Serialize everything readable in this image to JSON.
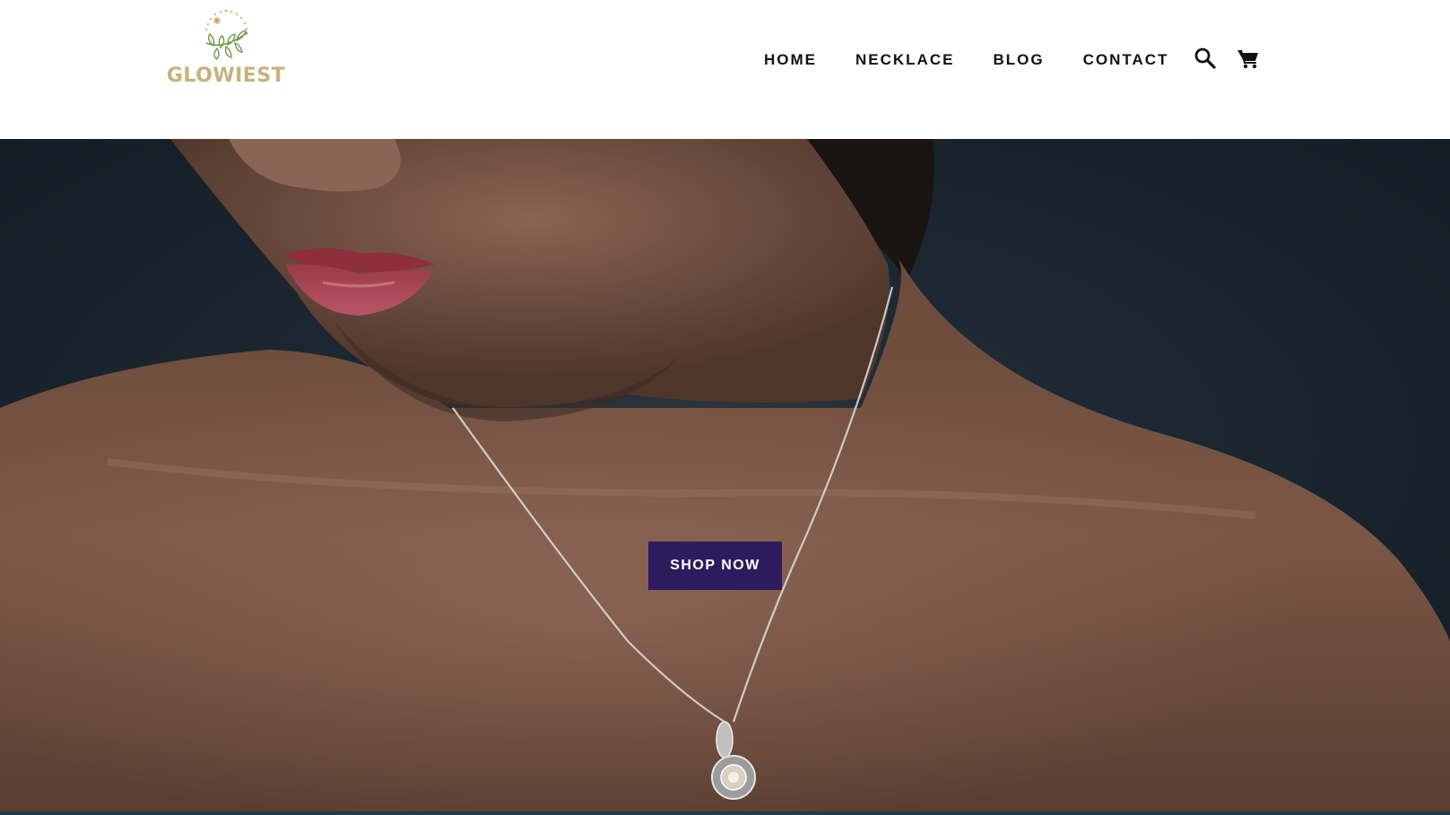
{
  "brand": {
    "name": "GLOWIEST",
    "logo_icon": "wreath-logo-icon",
    "logo_color": "#c8b27a",
    "leaf_color": "#6d9a4a"
  },
  "nav": {
    "items": [
      {
        "label": "HOME"
      },
      {
        "label": "NECKLACE"
      },
      {
        "label": "BLOG"
      },
      {
        "label": "CONTACT"
      }
    ]
  },
  "header_icons": {
    "search": "search-icon",
    "cart": "cart-icon"
  },
  "hero": {
    "image": "hero-image-woman-wearing-silver-necklace",
    "cta_label": "SHOP NOW",
    "cta_color": "#2d1b5e"
  }
}
